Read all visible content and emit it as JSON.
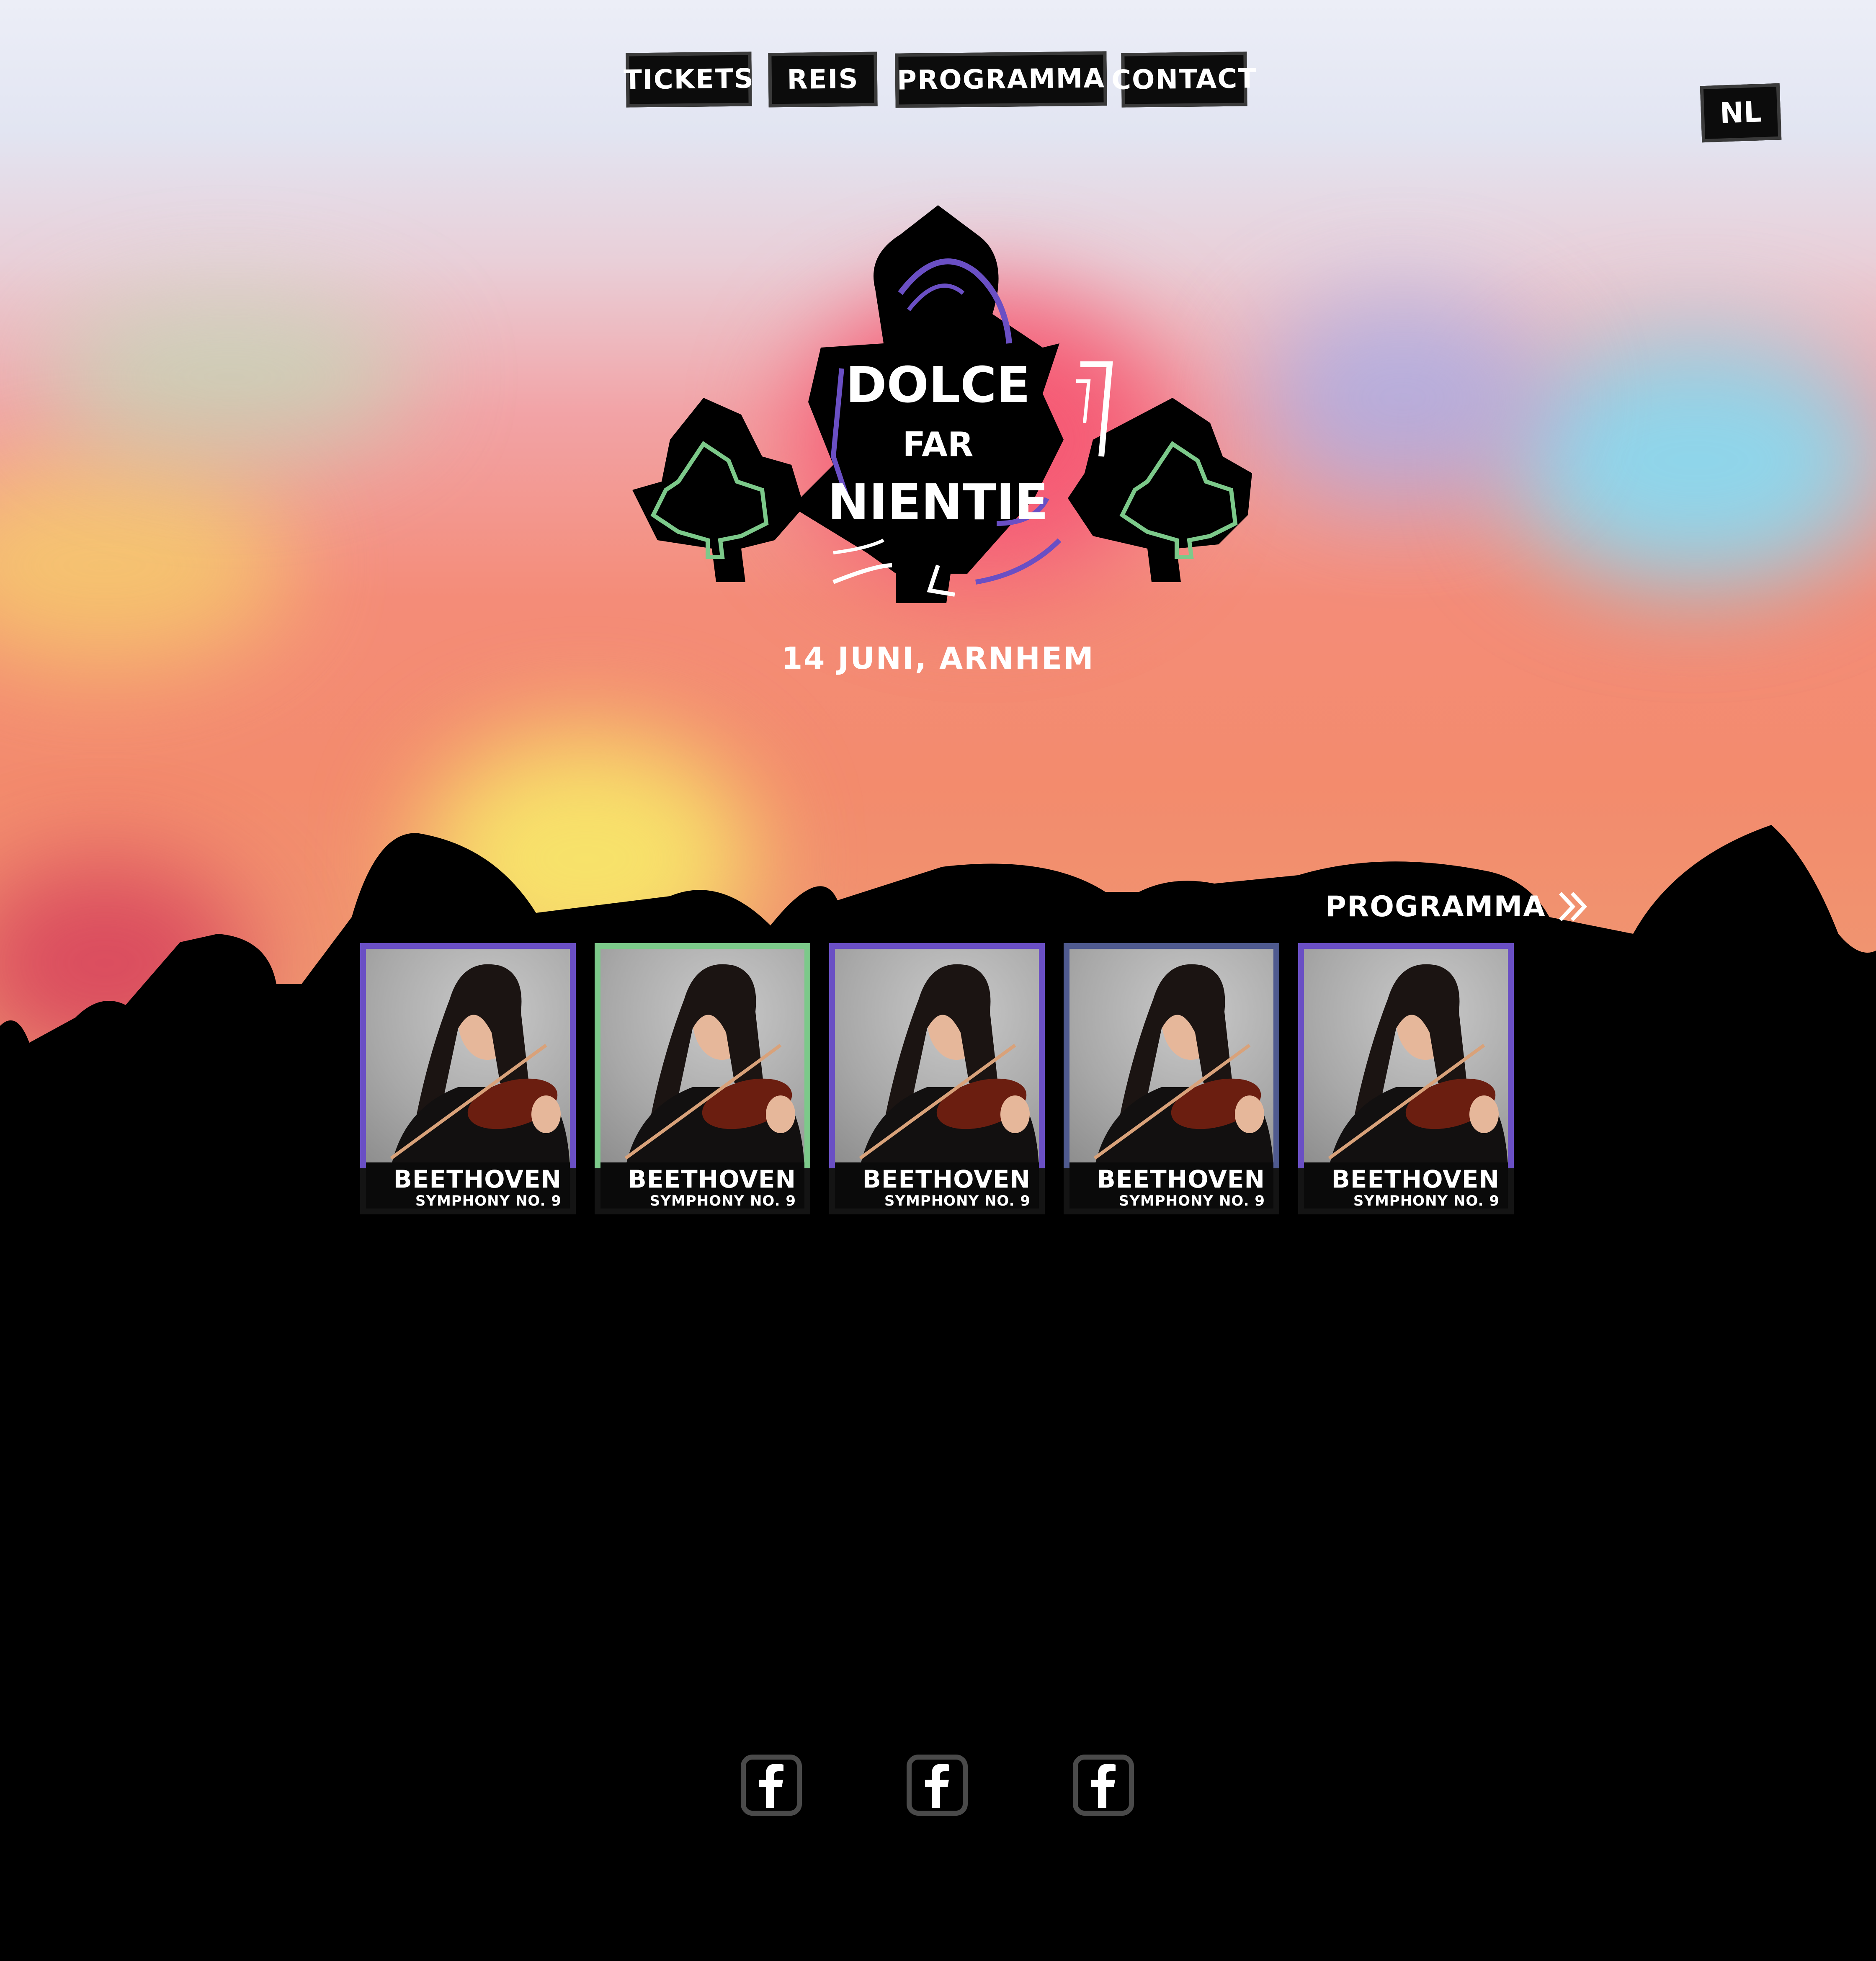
{
  "nav": {
    "items": [
      {
        "label": "TICKETS"
      },
      {
        "label": "REIS"
      },
      {
        "label": "PROGRAMMA"
      },
      {
        "label": "CONTACT"
      }
    ],
    "language": "NL"
  },
  "logo": {
    "line1": "DOLCE",
    "line2": "FAR",
    "line3": "NIENTIE"
  },
  "event": {
    "date_location": "14 JUNI, ARNHEM"
  },
  "program": {
    "link_label": "PROGRAMMA",
    "link_icon": "double-chevron-right-icon",
    "cards": [
      {
        "title": "BEETHOVEN",
        "subtitle": "SYMPHONY NO. 9",
        "border_color": "#6a4fc4"
      },
      {
        "title": "BEETHOVEN",
        "subtitle": "SYMPHONY NO. 9",
        "border_color": "#7cc98a"
      },
      {
        "title": "BEETHOVEN",
        "subtitle": "SYMPHONY NO. 9",
        "border_color": "#6a4fc4"
      },
      {
        "title": "BEETHOVEN",
        "subtitle": "SYMPHONY NO. 9",
        "border_color": "#4f5a8f"
      },
      {
        "title": "BEETHOVEN",
        "subtitle": "SYMPHONY NO. 9",
        "border_color": "#6a4fc4"
      }
    ]
  },
  "footer": {
    "social": [
      {
        "icon": "facebook-icon"
      },
      {
        "icon": "facebook-icon"
      },
      {
        "icon": "facebook-icon"
      }
    ]
  },
  "colors": {
    "accent_purple": "#6a4fc4",
    "accent_green": "#7cc98a",
    "background": "#000000"
  }
}
